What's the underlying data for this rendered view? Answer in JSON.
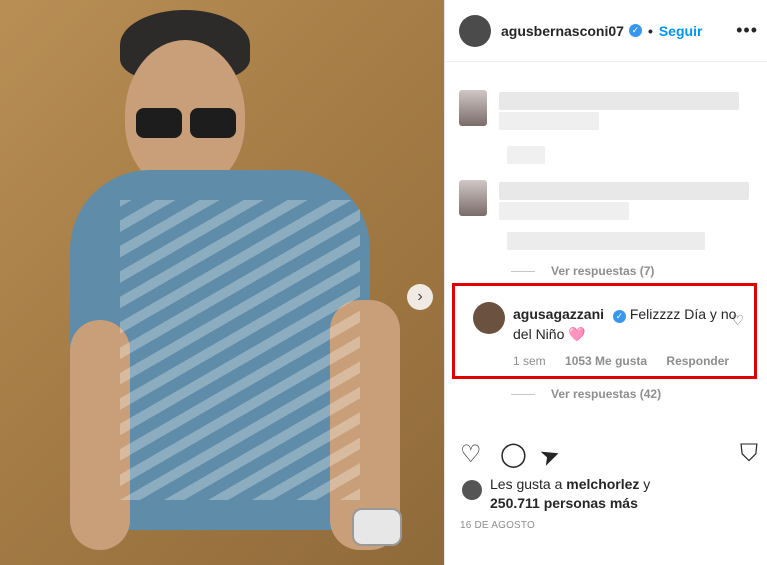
{
  "post": {
    "username": "agusbernasconi07",
    "verified_badge": "✓",
    "separator": "•",
    "follow_label": "Seguir",
    "more_label": "•••"
  },
  "comments": {
    "replies_1": "Ver respuestas (7)",
    "replies_2": "Ver respuestas (42)"
  },
  "highlighted_comment": {
    "username": "agusagazzani",
    "verified_badge": "✓",
    "text": "Felizzzz Día y no del Niño 🩷",
    "time": "1 sem",
    "likes": "1053 Me gusta",
    "reply": "Responder"
  },
  "likes": {
    "line1_prefix": "Les gusta a ",
    "line1_user": "melchorlez",
    "line1_suffix": " y",
    "line2": "250.711 personas más"
  },
  "date": "16 DE AGOSTO",
  "icons": {
    "heart": "♡",
    "comment": "◯",
    "share": "➤",
    "save": "⛉",
    "next": "›"
  },
  "colors": {
    "highlight_border": "#e00000",
    "follow": "#0095f6",
    "verified": "#3897f0"
  }
}
